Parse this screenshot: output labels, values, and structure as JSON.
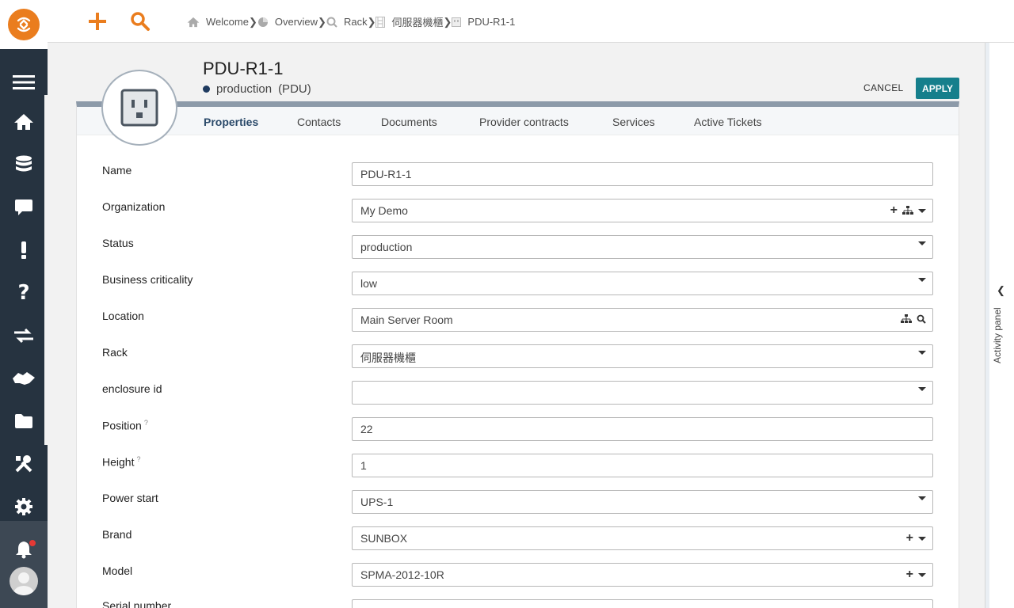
{
  "breadcrumb": [
    {
      "label": "Welcome",
      "icon": "home-icon"
    },
    {
      "label": "Overview",
      "icon": "pie-chart-icon"
    },
    {
      "label": "Rack",
      "icon": "search-icon"
    },
    {
      "label": "伺服器機櫃",
      "icon": "rack-icon"
    },
    {
      "label": "PDU-R1-1",
      "icon": "pdu-icon"
    }
  ],
  "object": {
    "title": "PDU-R1-1",
    "status": "production",
    "class": "(PDU)"
  },
  "actions": {
    "cancel": "CANCEL",
    "apply": "APPLY"
  },
  "tabs": [
    "Properties",
    "Contacts",
    "Documents",
    "Provider contracts",
    "Services",
    "Active Tickets"
  ],
  "form": {
    "name": {
      "label": "Name",
      "value": "PDU-R1-1"
    },
    "organization": {
      "label": "Organization",
      "value": "My Demo"
    },
    "status": {
      "label": "Status",
      "value": "production"
    },
    "business_criticality": {
      "label": "Business criticality",
      "value": "low"
    },
    "location": {
      "label": "Location",
      "value": "Main Server Room"
    },
    "rack": {
      "label": "Rack",
      "value": "伺服器機櫃"
    },
    "enclosure_id": {
      "label": "enclosure id",
      "value": ""
    },
    "position": {
      "label": "Position",
      "hint": "?",
      "value": "22"
    },
    "height": {
      "label": "Height",
      "hint": "?",
      "value": "1"
    },
    "power_start": {
      "label": "Power start",
      "value": "UPS-1"
    },
    "brand": {
      "label": "Brand",
      "value": "SUNBOX"
    },
    "model": {
      "label": "Model",
      "value": "SPMA-2012-10R"
    },
    "serial_number": {
      "label": "Serial number",
      "value": ""
    }
  },
  "activity_panel": {
    "label": "Activity panel"
  },
  "colors": {
    "accent": "#ea7d1e",
    "apply": "#167f8c",
    "sidebar": "#263340"
  }
}
